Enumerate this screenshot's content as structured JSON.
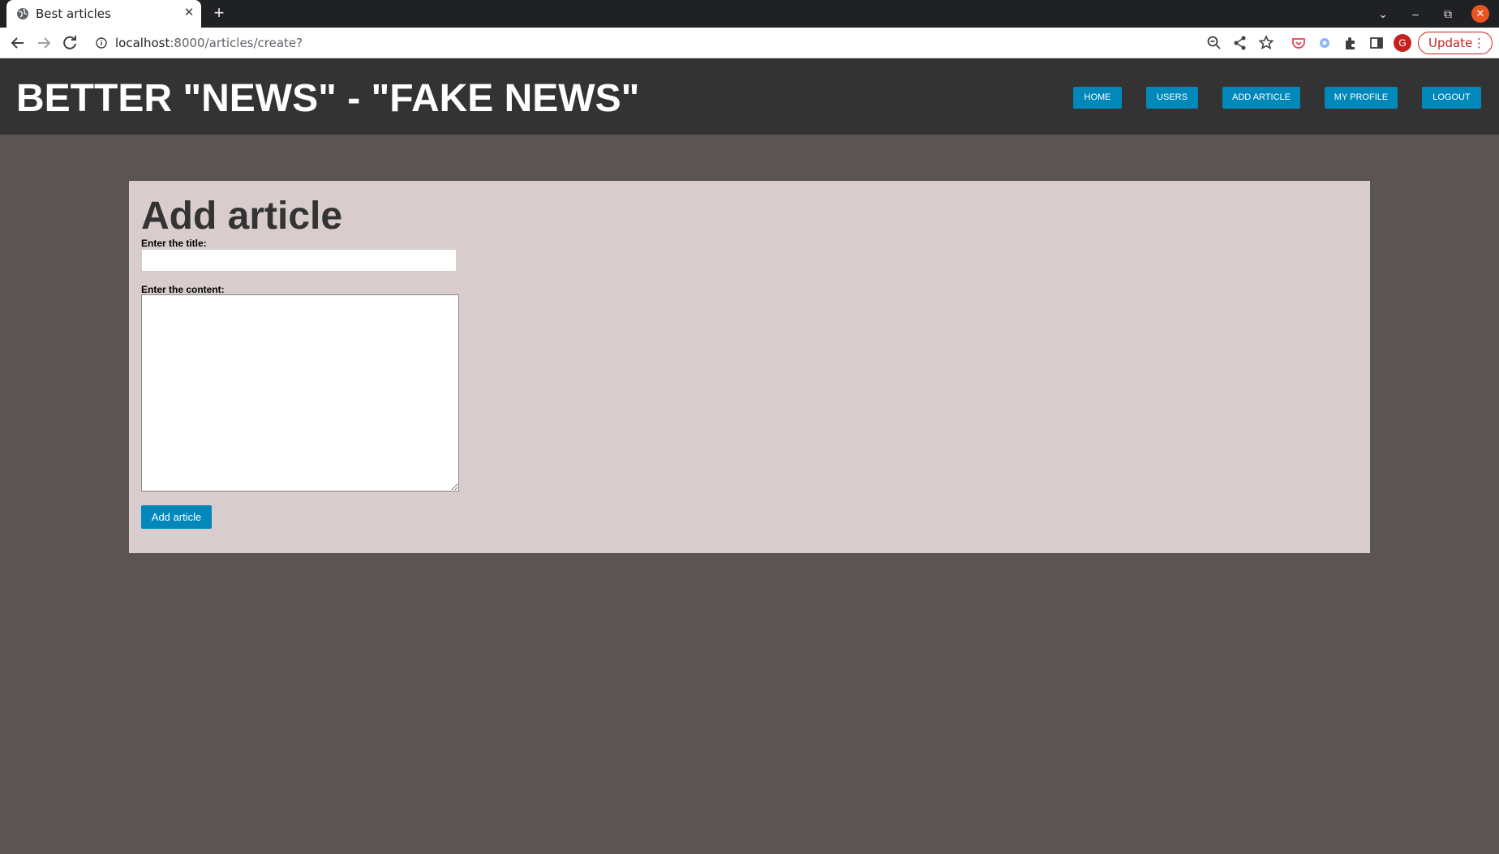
{
  "browser": {
    "tab_title": "Best articles",
    "new_tab": "+",
    "tab_close": "✕",
    "url_host": "localhost",
    "url_path": ":8000/articles/create?",
    "profile_initial": "G",
    "update_label": "Update",
    "menu_dots": "⋮",
    "window_controls": {
      "tab_search": "⌄",
      "minimize": "–",
      "restore": "⧉",
      "close": "✕"
    }
  },
  "site": {
    "title": "BETTER \"NEWS\" - \"FAKE NEWS\"",
    "nav": [
      "HOME",
      "USERS",
      "ADD ARTICLE",
      "MY PROFILE",
      "LOGOUT"
    ]
  },
  "form": {
    "heading": "Add article",
    "title_label": "Enter the title:",
    "title_value": "",
    "content_label": "Enter the content:",
    "content_value": "",
    "submit_label": "Add article"
  },
  "colors": {
    "page_bg": "#5a5454",
    "header_bg": "#333333",
    "panel_bg": "#d9cccc",
    "accent": "#0088bb",
    "update": "#c5221f",
    "window_close": "#e95420"
  }
}
